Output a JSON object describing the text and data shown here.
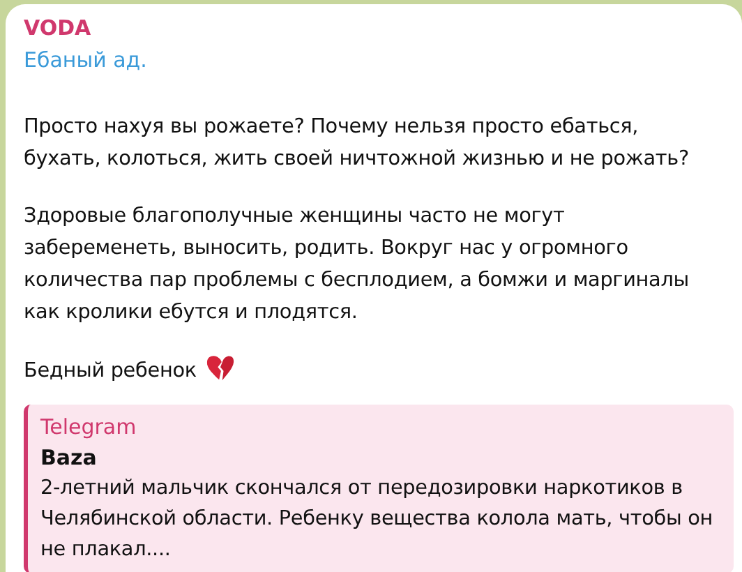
{
  "message": {
    "sender": "VODA",
    "link": "Ебаный ад.",
    "paragraphs": [
      "Просто нахуя вы рожаете? Почему нельзя просто ебаться, бухать, колоться, жить своей ничтожной жизнью и не рожать?",
      "Здоровые благополучные женщины часто не могут забеременеть, выносить, родить. Вокруг нас у огромного количества пар проблемы с бесплодием, а бомжи и маргиналы как кролики ебутся и плодятся.",
      "Бедный ребенок"
    ],
    "quote": {
      "source": "Telegram",
      "author": "Baza",
      "text": "2-летний мальчик скончался от передозировки наркотиков в Челябинской области. Ребенку вещества колола мать, чтобы он не плакал...."
    }
  }
}
